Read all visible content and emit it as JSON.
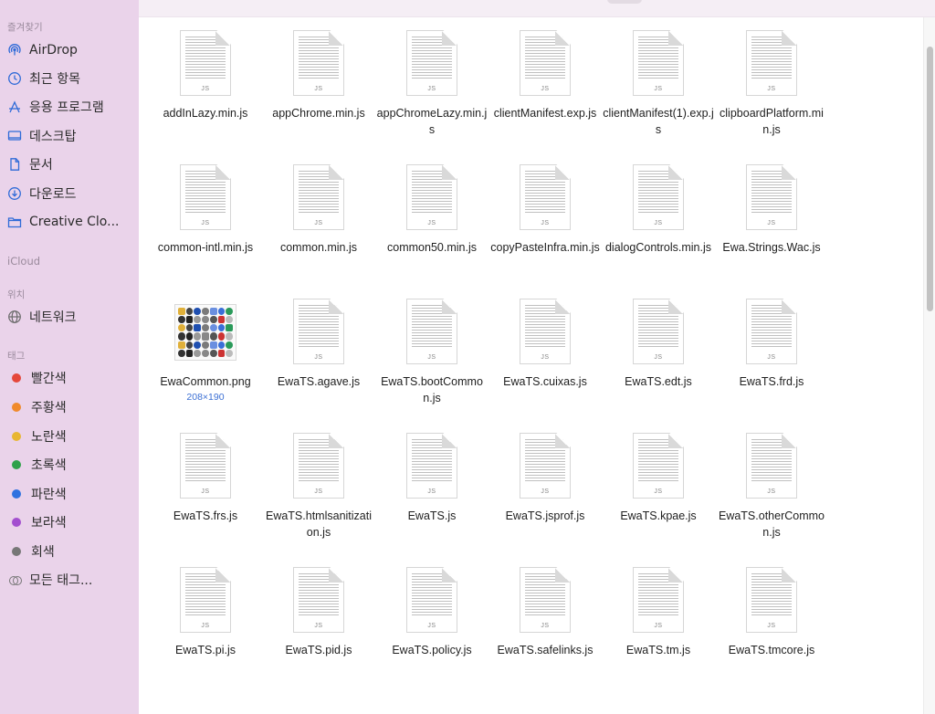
{
  "sidebar": {
    "favorites_header": "즐겨찾기",
    "favorites": [
      {
        "label": "AirDrop",
        "icon": "airdrop-icon"
      },
      {
        "label": "최근 항목",
        "icon": "clock-icon"
      },
      {
        "label": "응용 프로그램",
        "icon": "applications-icon"
      },
      {
        "label": "데스크탑",
        "icon": "desktop-icon"
      },
      {
        "label": "문서",
        "icon": "document-icon"
      },
      {
        "label": "다운로드",
        "icon": "download-icon"
      },
      {
        "label": "Creative Clo...",
        "icon": "folder-icon"
      }
    ],
    "icloud_header": "iCloud",
    "locations_header": "위치",
    "locations": [
      {
        "label": "네트워크",
        "icon": "network-icon"
      }
    ],
    "tags_header": "태그",
    "tags": [
      {
        "label": "빨간색",
        "color": "#e5473a"
      },
      {
        "label": "주황색",
        "color": "#f08a2c"
      },
      {
        "label": "노란색",
        "color": "#e8b632"
      },
      {
        "label": "초록색",
        "color": "#2fa14a"
      },
      {
        "label": "파란색",
        "color": "#2f72e0"
      },
      {
        "label": "보라색",
        "color": "#a34fcf"
      },
      {
        "label": "회색",
        "color": "#777777"
      }
    ],
    "all_tags": {
      "label": "모든 태그...",
      "icon": "all-tags-icon"
    }
  },
  "files": [
    {
      "name": "addInLazy.min.js",
      "type": "js"
    },
    {
      "name": "appChrome.min.js",
      "type": "js"
    },
    {
      "name": "appChromeLazy.min.js",
      "type": "js"
    },
    {
      "name": "clientManifest.exp.js",
      "type": "js"
    },
    {
      "name": "clientManifest(1).exp.js",
      "type": "js"
    },
    {
      "name": "clipboardPlatform.min.js",
      "type": "js"
    },
    {
      "name": "common-intl.min.js",
      "type": "js"
    },
    {
      "name": "common.min.js",
      "type": "js"
    },
    {
      "name": "common50.min.js",
      "type": "js"
    },
    {
      "name": "copyPasteInfra.min.js",
      "type": "js"
    },
    {
      "name": "dialogControls.min.js",
      "type": "js"
    },
    {
      "name": "Ewa.Strings.Wac.js",
      "type": "js"
    },
    {
      "name": "EwaCommon.png",
      "type": "png",
      "dimensions": "208×190"
    },
    {
      "name": "EwaTS.agave.js",
      "type": "js"
    },
    {
      "name": "EwaTS.bootCommon.js",
      "type": "js"
    },
    {
      "name": "EwaTS.cuixas.js",
      "type": "js"
    },
    {
      "name": "EwaTS.edt.js",
      "type": "js"
    },
    {
      "name": "EwaTS.frd.js",
      "type": "js"
    },
    {
      "name": "EwaTS.frs.js",
      "type": "js"
    },
    {
      "name": "EwaTS.htmlsanitization.js",
      "type": "js"
    },
    {
      "name": "EwaTS.js",
      "type": "js"
    },
    {
      "name": "EwaTS.jsprof.js",
      "type": "js"
    },
    {
      "name": "EwaTS.kpae.js",
      "type": "js"
    },
    {
      "name": "EwaTS.otherCommon.js",
      "type": "js"
    },
    {
      "name": "EwaTS.pi.js",
      "type": "js"
    },
    {
      "name": "EwaTS.pid.js",
      "type": "js"
    },
    {
      "name": "EwaTS.policy.js",
      "type": "js"
    },
    {
      "name": "EwaTS.safelinks.js",
      "type": "js"
    },
    {
      "name": "EwaTS.tm.js",
      "type": "js"
    },
    {
      "name": "EwaTS.tmcore.js",
      "type": "js"
    }
  ],
  "file_ext_label": "JS",
  "colors": {
    "sidebar_bg": "#ead3ea",
    "accent": "#3b6fd4"
  }
}
